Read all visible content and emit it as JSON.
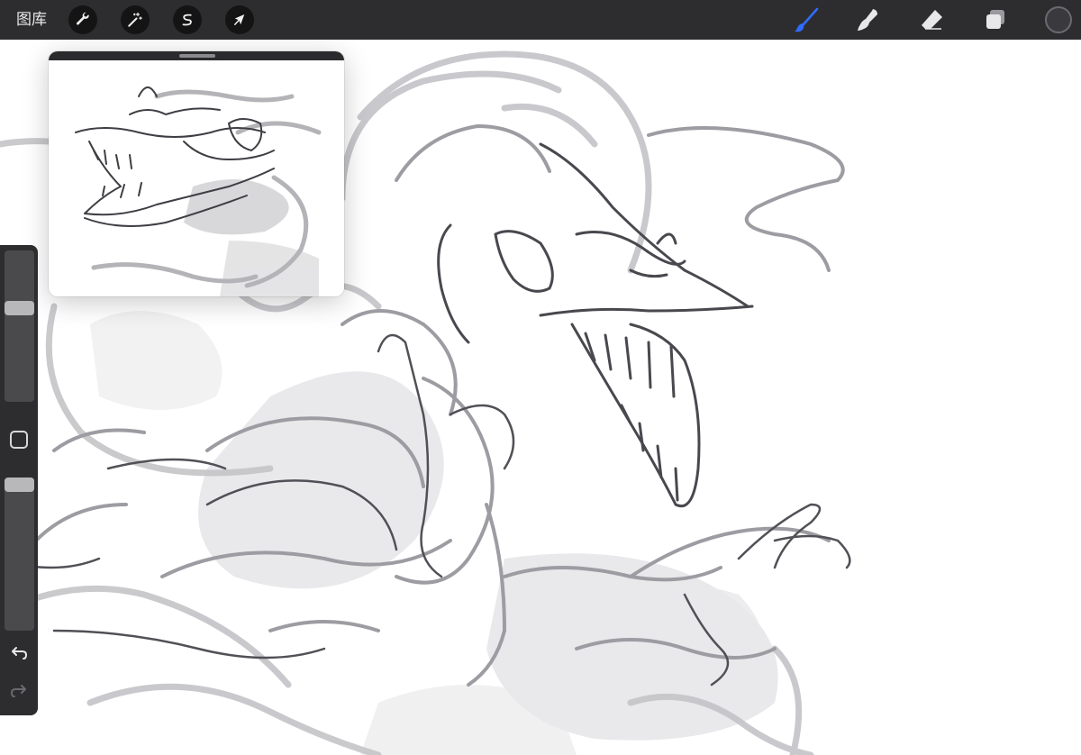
{
  "toolbar": {
    "gallery_label": "图库",
    "left_tools": [
      {
        "name": "actions",
        "icon": "wrench-icon"
      },
      {
        "name": "adjustments",
        "icon": "magic-wand-icon"
      },
      {
        "name": "selection",
        "icon": "selection-s-icon"
      },
      {
        "name": "transform",
        "icon": "arrow-cursor-icon"
      }
    ],
    "right_tools": [
      {
        "name": "brush",
        "icon": "brush-icon",
        "active": true
      },
      {
        "name": "smudge",
        "icon": "smudge-finger-icon"
      },
      {
        "name": "eraser",
        "icon": "eraser-icon"
      },
      {
        "name": "layers",
        "icon": "layers-icon"
      }
    ],
    "current_color": "#3a3a3e",
    "active_color": "#2f6bff"
  },
  "sidebar": {
    "brush_size": 0.63,
    "brush_opacity": 1.0,
    "icons": {
      "modify": "square-modify-icon",
      "undo": "undo-icon",
      "redo": "redo-icon"
    }
  },
  "reference_window": {
    "icon": "drag-handle-icon"
  }
}
